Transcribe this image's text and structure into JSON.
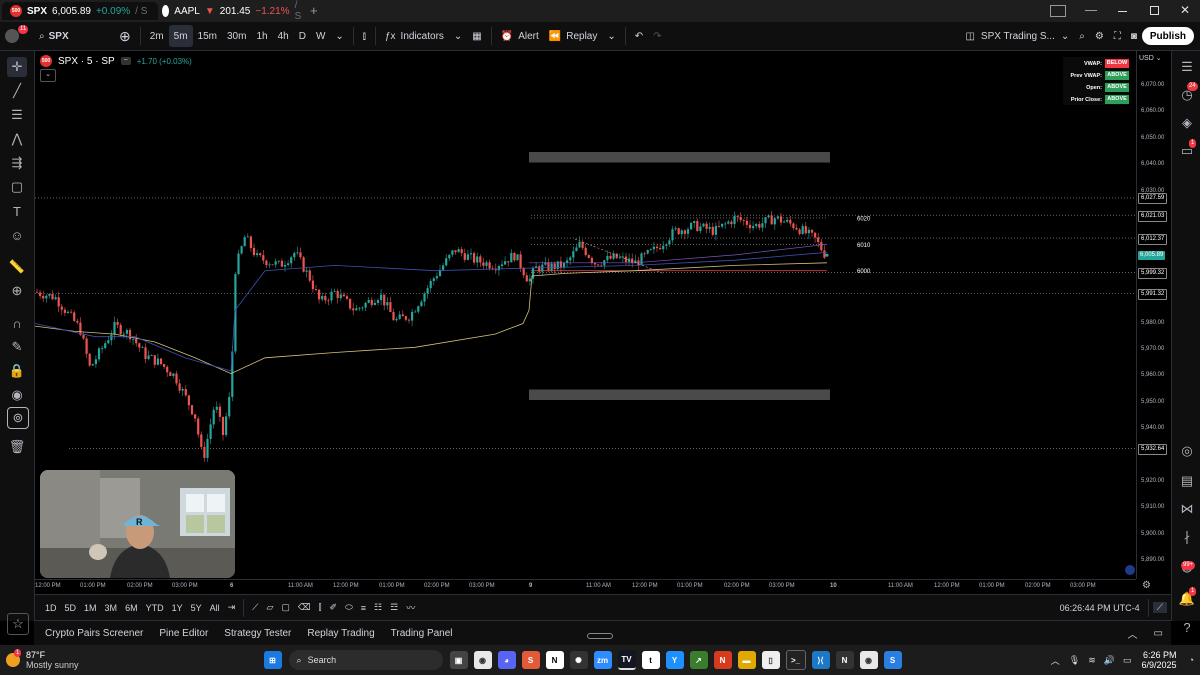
{
  "browser_tabs": [
    {
      "symbol": "SPX",
      "price": "6,005.89",
      "change": "+0.09%",
      "extra": "/ S",
      "direction": "up"
    },
    {
      "symbol": "AAPL",
      "price": "201.45",
      "change": "−1.21%",
      "extra": "/ S",
      "direction": "down"
    }
  ],
  "toolbar": {
    "badge_count": "11",
    "symbol": "SPX",
    "timeframes": [
      "2m",
      "5m",
      "15m",
      "30m",
      "1h",
      "4h",
      "D",
      "W"
    ],
    "selected_timeframe": "5m",
    "indicators_label": "Indicators",
    "alert_label": "Alert",
    "replay_label": "Replay",
    "layout_name": "SPX Trading S...",
    "publish_label": "Publish"
  },
  "legend": {
    "title": "SPX · 5 · SP",
    "change": "+1.70 (+0.03%)"
  },
  "vwap_panel": [
    {
      "label": "VWAP:",
      "value": "BELOW",
      "color": "#f23645"
    },
    {
      "label": "Prev VWAP:",
      "value": "ABOVE",
      "color": "#2e9e5b"
    },
    {
      "label": "Open:",
      "value": "ABOVE",
      "color": "#2e9e5b"
    },
    {
      "label": "Prior Close:",
      "value": "ABOVE",
      "color": "#2e9e5b"
    }
  ],
  "price_axis": {
    "currency": "USD",
    "ticks": [
      "6,070.00",
      "6,060.00",
      "6,050.00",
      "6,040.00",
      "6,030.00",
      "5,980.00",
      "5,970.00",
      "5,960.00",
      "5,950.00",
      "5,940.00",
      "5,920.00",
      "5,910.00",
      "5,900.00",
      "5,890.00"
    ],
    "labels": [
      {
        "text": "6,027.59",
        "style": "outline"
      },
      {
        "text": "6,021.03",
        "style": "outline"
      },
      {
        "text": "6,012.37",
        "style": "outline"
      },
      {
        "text": "6,005.89",
        "style": "current"
      },
      {
        "text": "5,999.32",
        "style": "outline"
      },
      {
        "text": "5,991.32",
        "style": "outline"
      },
      {
        "text": "5,932.64",
        "style": "outline"
      }
    ]
  },
  "level_labels": [
    "6020",
    "6010",
    "6000"
  ],
  "time_axis": [
    "12:00 PM",
    "01:00 PM",
    "02:00 PM",
    "03:00 PM",
    "6",
    "11:00 AM",
    "12:00 PM",
    "01:00 PM",
    "02:00 PM",
    "03:00 PM",
    "9",
    "11:00 AM",
    "12:00 PM",
    "01:00 PM",
    "02:00 PM",
    "03:00 PM",
    "10",
    "11:00 AM",
    "12:00 PM",
    "01:00 PM",
    "02:00 PM",
    "03:00 PM"
  ],
  "range_bar": {
    "ranges": [
      "1D",
      "5D",
      "1M",
      "3M",
      "6M",
      "YTD",
      "1Y",
      "5Y",
      "All"
    ],
    "clock": "06:26:44 PM UTC-4"
  },
  "bottom_panels": [
    "Crypto Pairs Screener",
    "Pine Editor",
    "Strategy Tester",
    "Replay Trading",
    "Trading Panel"
  ],
  "right_rail_badges": {
    "alerts": "24",
    "chat": "1",
    "notifications": "99+",
    "bell": "1"
  },
  "taskbar": {
    "weather_temp": "87°F",
    "weather_desc": "Mostly sunny",
    "weather_badge": "1",
    "search_placeholder": "Search",
    "time": "6:26 PM",
    "date": "6/9/2025"
  },
  "chart_data": {
    "type": "candlestick",
    "symbol": "SPX",
    "interval": "5m",
    "y_range": [
      5885,
      6080
    ],
    "horizontal_levels": [
      6027.59,
      6021.03,
      6012.37,
      5999.32,
      5991.32,
      5932.64
    ],
    "drawn_levels": [
      6020,
      6010,
      6000
    ],
    "zones": [
      [
        6041,
        6045
      ],
      [
        5951,
        5955
      ]
    ],
    "last_price": 6005.89
  }
}
